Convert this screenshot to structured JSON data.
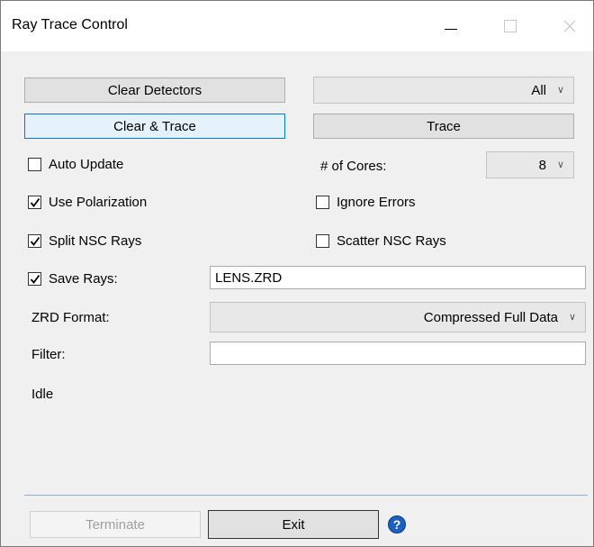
{
  "window": {
    "title": "Ray Trace Control"
  },
  "buttons": {
    "clear_detectors": "Clear Detectors",
    "clear_and_trace": "Clear & Trace",
    "trace": "Trace",
    "terminate": "Terminate",
    "exit": "Exit"
  },
  "detector_select": {
    "value": "All",
    "icon": "chevron-down-icon"
  },
  "cores": {
    "label": "# of Cores:",
    "value": "8"
  },
  "options": {
    "auto_update": {
      "label": "Auto Update",
      "checked": false
    },
    "use_polarization": {
      "label": "Use Polarization",
      "checked": true
    },
    "split_nsc_rays": {
      "label": "Split NSC Rays",
      "checked": true
    },
    "ignore_errors": {
      "label": "Ignore Errors",
      "checked": false
    },
    "scatter_nsc_rays": {
      "label": "Scatter NSC Rays",
      "checked": false
    },
    "save_rays": {
      "label": "Save Rays:",
      "checked": true
    }
  },
  "save_rays_file": "LENS.ZRD",
  "zrd_format": {
    "label": "ZRD Format:",
    "value": "Compressed Full Data"
  },
  "filter": {
    "label": "Filter:",
    "value": ""
  },
  "status": "Idle",
  "help": {
    "glyph": "?",
    "icon": "help-icon"
  }
}
